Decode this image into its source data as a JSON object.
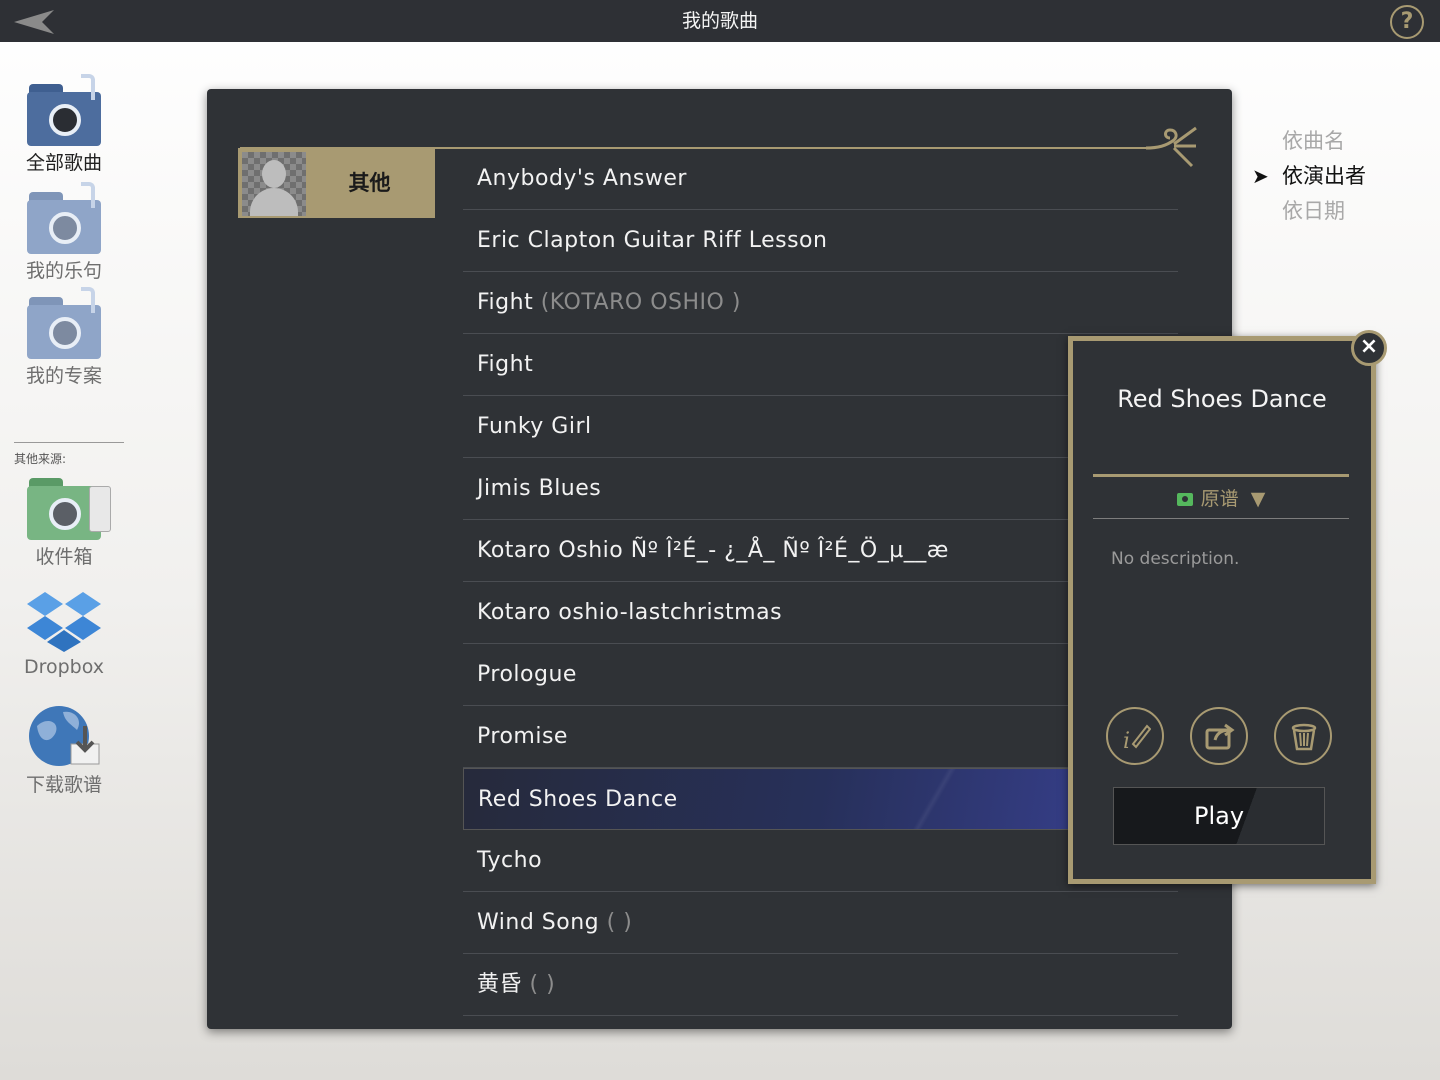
{
  "header": {
    "title": "我的歌曲"
  },
  "sidebar": {
    "items": [
      {
        "label": "全部歌曲",
        "icon": "all-songs-folder-icon",
        "color": "#4d6d9e"
      },
      {
        "label": "我的乐句",
        "icon": "phrases-folder-icon",
        "color": "#8fa5c8"
      },
      {
        "label": "我的专案",
        "icon": "projects-folder-icon",
        "color": "#8fa5c8"
      }
    ],
    "other_sources_label": "其他来源:",
    "sources": [
      {
        "label": "收件箱",
        "icon": "inbox-folder-icon"
      },
      {
        "label": "Dropbox",
        "icon": "dropbox-icon"
      },
      {
        "label": "下载歌谱",
        "icon": "download-globe-icon"
      }
    ]
  },
  "artist": {
    "name": "其他"
  },
  "songs": [
    {
      "title": "Anybody's Answer",
      "artist": ""
    },
    {
      "title": "Eric Clapton Guitar Riff Lesson",
      "artist": ""
    },
    {
      "title": "Fight",
      "artist": "(KOTARO OSHIO )"
    },
    {
      "title": "Fight",
      "artist": ""
    },
    {
      "title": "Funky Girl",
      "artist": ""
    },
    {
      "title": "Jimis Blues",
      "artist": ""
    },
    {
      "title": "Kotaro Oshio Ñº Î²É_- ¿_Å_ Ñº Î²É_Ö_µ__æ",
      "artist": ""
    },
    {
      "title": "Kotaro oshio-lastchristmas",
      "artist": ""
    },
    {
      "title": "Prologue",
      "artist": ""
    },
    {
      "title": "Promise",
      "artist": ""
    },
    {
      "title": "Red Shoes Dance",
      "artist": "",
      "selected": true
    },
    {
      "title": "Tycho",
      "artist": ""
    },
    {
      "title": "Wind Song",
      "artist": "( )"
    },
    {
      "title": "黄昏",
      "artist": "( )"
    }
  ],
  "sort": {
    "options": [
      {
        "label": "依曲名",
        "active": false
      },
      {
        "label": "依演出者",
        "active": true
      },
      {
        "label": "依日期",
        "active": false
      }
    ],
    "arrow": "➤"
  },
  "popup": {
    "close": "×",
    "title": "Red Shoes Dance",
    "score_label": "原谱",
    "score_dropdown_arrow": "▼",
    "description": "No description.",
    "play_label": "Play"
  },
  "colors": {
    "accent_gold": "#a89a72",
    "panel": "#2f3236",
    "topbar": "#2e3035",
    "selected_row": "#3a4296"
  }
}
